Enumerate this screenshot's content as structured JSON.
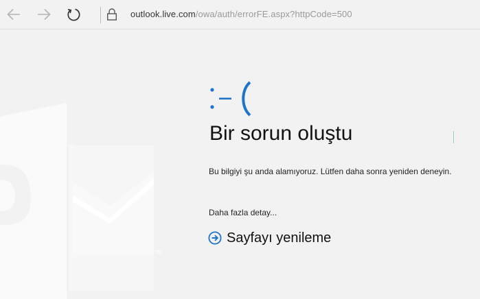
{
  "browser": {
    "url_host": "outlook.live.com",
    "url_path": "/owa/auth/errorFE.aspx?httpCode=500"
  },
  "error": {
    "emoticon": ":-(",
    "title": "Bir sorun oluştu",
    "message": "Bu bilgiyi şu anda alamıyoruz. Lütfen daha sonra yeniden deneyin.",
    "details_link": "Daha fazla detay...",
    "refresh_label": "Sayfayı yenileme"
  },
  "colors": {
    "accent": "#1e74c9",
    "background": "#f2f2f2",
    "watermark": "#ffffff"
  },
  "icons": {
    "back": "back-arrow-icon",
    "forward": "forward-arrow-icon",
    "refresh": "refresh-icon",
    "lock": "lock-icon",
    "refresh_link": "circle-arrow-right-icon",
    "watermark": "outlook-logo-icon"
  }
}
